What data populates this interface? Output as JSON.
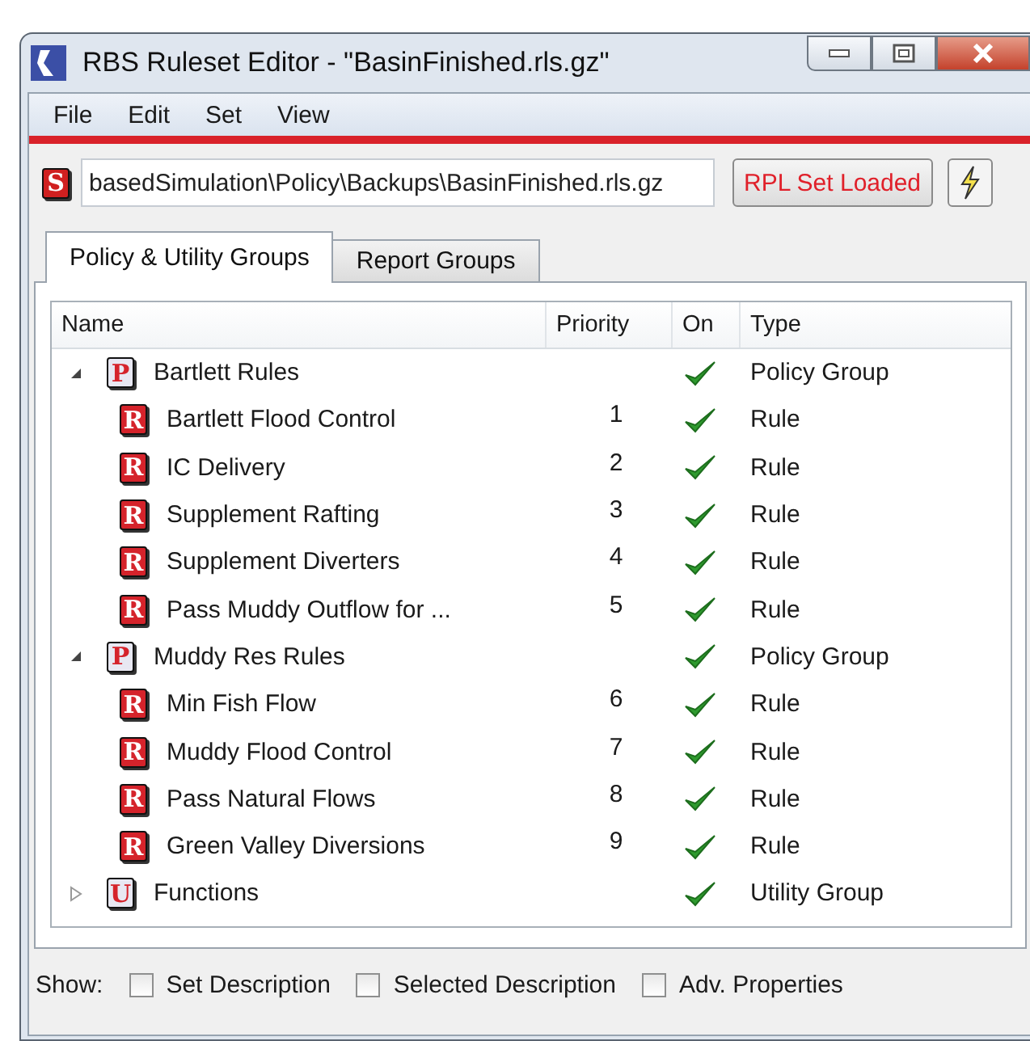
{
  "window": {
    "title": "RBS Ruleset Editor - \"BasinFinished.rls.gz\""
  },
  "menu": [
    "File",
    "Edit",
    "Set",
    "View"
  ],
  "path_bar": {
    "badge": "S",
    "value": "basedSimulation\\Policy\\Backups\\BasinFinished.rls.gz",
    "status_button": "RPL Set Loaded"
  },
  "tabs": [
    {
      "label": "Policy & Utility Groups",
      "selected": true
    },
    {
      "label": "Report Groups",
      "selected": false
    }
  ],
  "table": {
    "columns": [
      "Name",
      "Priority",
      "On",
      "Type"
    ],
    "rows": [
      {
        "badge": "P",
        "name": "Bartlett Rules",
        "priority": "",
        "on": true,
        "type": "Policy Group",
        "expanded": true,
        "children": [
          {
            "badge": "R",
            "name": "Bartlett Flood Control",
            "priority": "1",
            "on": true,
            "type": "Rule"
          },
          {
            "badge": "R",
            "name": "IC Delivery",
            "priority": "2",
            "on": true,
            "type": "Rule"
          },
          {
            "badge": "R",
            "name": "Supplement Rafting",
            "priority": "3",
            "on": true,
            "type": "Rule"
          },
          {
            "badge": "R",
            "name": "Supplement Diverters",
            "priority": "4",
            "on": true,
            "type": "Rule"
          },
          {
            "badge": "R",
            "name": "Pass Muddy Outflow for ...",
            "priority": "5",
            "on": true,
            "type": "Rule"
          }
        ]
      },
      {
        "badge": "P",
        "name": "Muddy Res Rules",
        "priority": "",
        "on": true,
        "type": "Policy Group",
        "expanded": true,
        "children": [
          {
            "badge": "R",
            "name": "Min Fish Flow",
            "priority": "6",
            "on": true,
            "type": "Rule"
          },
          {
            "badge": "R",
            "name": "Muddy Flood Control",
            "priority": "7",
            "on": true,
            "type": "Rule"
          },
          {
            "badge": "R",
            "name": "Pass Natural Flows",
            "priority": "8",
            "on": true,
            "type": "Rule"
          },
          {
            "badge": "R",
            "name": "Green Valley Diversions",
            "priority": "9",
            "on": true,
            "type": "Rule"
          }
        ]
      },
      {
        "badge": "U",
        "name": "Functions",
        "priority": "",
        "on": true,
        "type": "Utility Group",
        "expanded": false,
        "children": []
      }
    ]
  },
  "show_bar": {
    "label": "Show:",
    "options": [
      {
        "label": "Set Description",
        "checked": false
      },
      {
        "label": "Selected Description",
        "checked": false
      },
      {
        "label": "Adv. Properties",
        "checked": false
      }
    ]
  }
}
